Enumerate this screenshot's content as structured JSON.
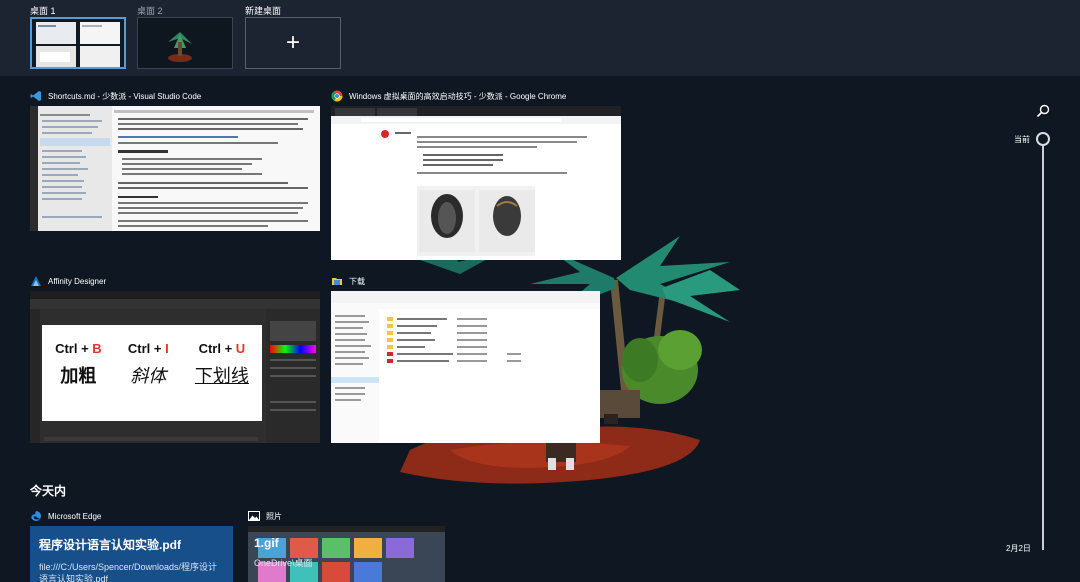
{
  "desktops": [
    {
      "label": "桌面 1",
      "active": true
    },
    {
      "label": "桌面 2",
      "active": false
    },
    {
      "label": "新建桌面",
      "icon": "plus-icon"
    }
  ],
  "new_desktop_glyph": "+",
  "windows": [
    {
      "app": "Visual Studio Code",
      "icon": "vscode-icon",
      "title": "Shortcuts.md - 少数派 - Visual Studio Code"
    },
    {
      "app": "Google Chrome",
      "icon": "chrome-icon",
      "title": "Windows 虚拟桌面的高效启动技巧 - 少数派 - Google Chrome"
    },
    {
      "app": "Affinity Designer",
      "icon": "affinity-designer-icon",
      "title": "Affinity Designer"
    },
    {
      "app": "File Explorer",
      "icon": "folder-icon",
      "title": "下载"
    }
  ],
  "designer_canvas": {
    "shortcuts": [
      {
        "combo_prefix": "Ctrl + ",
        "key": "B",
        "label": "加粗"
      },
      {
        "combo_prefix": "Ctrl + ",
        "key": "I",
        "label": "斜体"
      },
      {
        "combo_prefix": "Ctrl + ",
        "key": "U",
        "label": "下划线"
      }
    ],
    "key_color": "#e3342f"
  },
  "timeline": {
    "section_title": "今天内",
    "current_label": "当前",
    "date_label": "2月2日",
    "cards": [
      {
        "app": "Microsoft Edge",
        "icon": "edge-icon",
        "title": "程序设计语言认知实验.pdf",
        "subtitle": "file:///C:/Users/Spencer/Downloads/程序设计语言认知实验.pdf"
      },
      {
        "app": "照片",
        "icon": "photos-icon",
        "title": "1.gif",
        "subtitle": "OneDrive\\桌面"
      }
    ]
  },
  "colors": {
    "background": "#0f1822",
    "top_bar": "#1b2430",
    "active_border": "#5b9bd5",
    "edge_card": "#174f8a"
  }
}
